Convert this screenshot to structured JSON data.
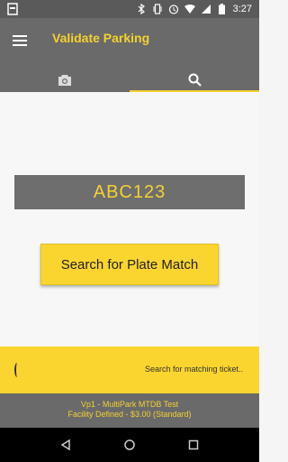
{
  "status_bar": {
    "time": "3:27"
  },
  "app_bar": {
    "title": "Validate Parking",
    "tabs": [
      {
        "icon": "camera-icon",
        "selected": false
      },
      {
        "icon": "search-icon",
        "selected": true
      }
    ]
  },
  "main": {
    "plate": "ABC123",
    "search_button_label": "Search for Plate Match"
  },
  "search_bar": {
    "status_text": "Search for matching ticket.."
  },
  "footer": {
    "line1": "Vp1 - MultiPark MTDB Test",
    "line2": "Facility Defined - $3.00 (Standard)"
  },
  "colors": {
    "accent": "#fbd52f",
    "appbar": "#6a6a6a",
    "statusbar": "#5a5a5a"
  }
}
